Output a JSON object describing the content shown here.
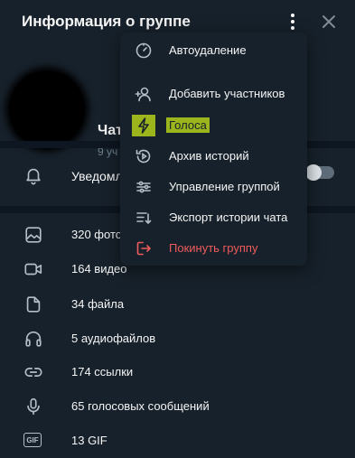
{
  "header": {
    "title": "Информация о группе",
    "more_icon": "more-vertical-icon",
    "close_icon": "close-icon"
  },
  "profile": {
    "name": "Чат",
    "subtitle": "9 уч"
  },
  "notifications": {
    "label": "Уведомл",
    "enabled": false
  },
  "media": [
    {
      "icon": "photo-icon",
      "label": "320 фото"
    },
    {
      "icon": "video-icon",
      "label": "164 видео"
    },
    {
      "icon": "file-icon",
      "label": "34 файла"
    },
    {
      "icon": "headphones-icon",
      "label": "5 аудиофайлов"
    },
    {
      "icon": "link-icon",
      "label": "174 ссылки"
    },
    {
      "icon": "microphone-icon",
      "label": "65 голосовых сообщений"
    },
    {
      "icon": "gif-icon",
      "label": "13 GIF",
      "badge": "GIF"
    }
  ],
  "menu": {
    "items": [
      {
        "icon": "timer-icon",
        "label": "Автоудаление"
      },
      {
        "icon": "add-user-icon",
        "label": "Добавить участников"
      },
      {
        "icon": "lightning-icon",
        "label": "Голоса",
        "highlighted": true
      },
      {
        "icon": "story-archive-icon",
        "label": "Архив историй"
      },
      {
        "icon": "sliders-icon",
        "label": "Управление группой"
      },
      {
        "icon": "export-icon",
        "label": "Экспорт истории чата"
      },
      {
        "icon": "leave-icon",
        "label": "Покинуть группу",
        "danger": true
      }
    ]
  },
  "colors": {
    "background": "#17212b",
    "separator": "#0e1621",
    "danger": "#ef5b5b",
    "highlight": "#9db51c",
    "icon": "#b4bec8"
  }
}
